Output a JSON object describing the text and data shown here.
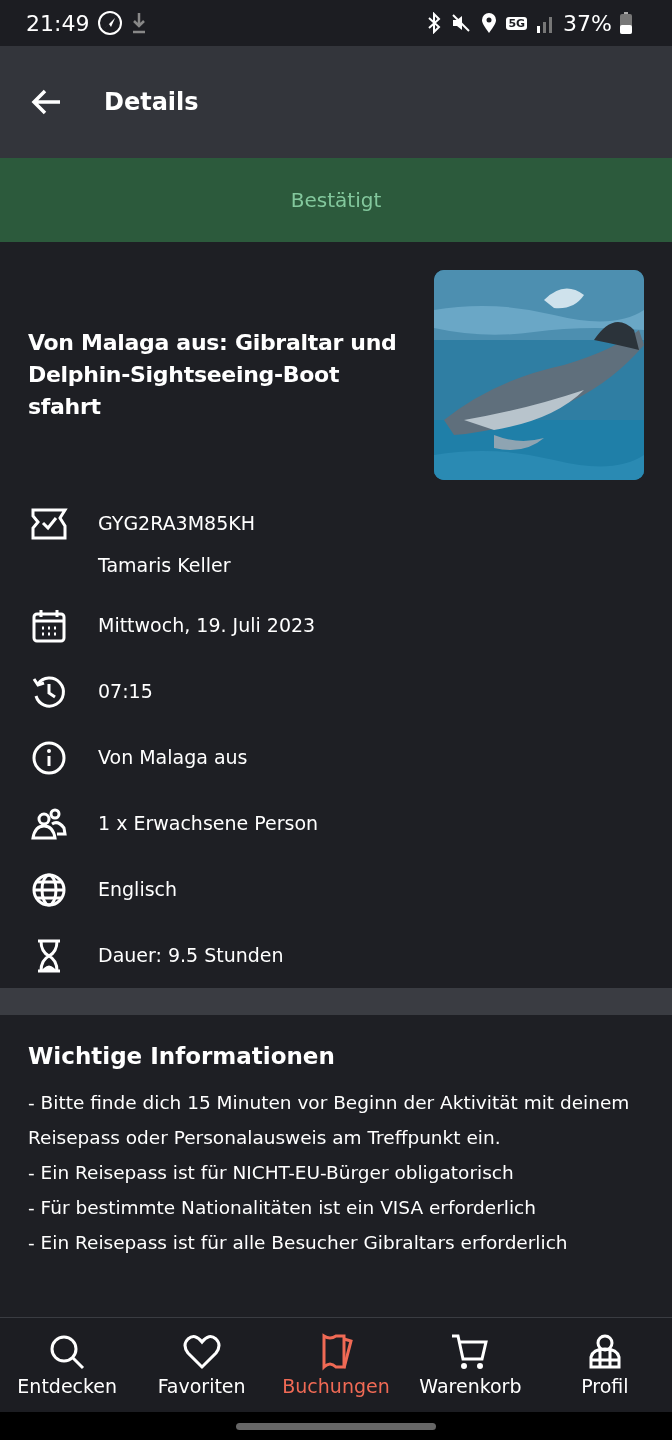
{
  "status_bar": {
    "time": "21:49",
    "battery": "37%",
    "network": "5G"
  },
  "app_bar": {
    "title": "Details"
  },
  "status_banner": {
    "label": "Bestätigt"
  },
  "activity": {
    "title": "Von Malaga aus: Gibraltar und Delphin-Sightseeing-Boot sfahrt"
  },
  "details": [
    {
      "kind": "ticket",
      "lines": [
        "GYG2RA3M85KH",
        "Tamaris Keller"
      ]
    },
    {
      "kind": "calendar",
      "lines": [
        "Mittwoch, 19. Juli 2023"
      ]
    },
    {
      "kind": "time",
      "lines": [
        "07:15"
      ]
    },
    {
      "kind": "info",
      "lines": [
        "Von Malaga aus"
      ]
    },
    {
      "kind": "people",
      "lines": [
        "1 x Erwachsene Person"
      ]
    },
    {
      "kind": "language",
      "lines": [
        "Englisch"
      ]
    },
    {
      "kind": "duration",
      "lines": [
        "Dauer: 9.5 Stunden"
      ]
    }
  ],
  "important_info": {
    "title": "Wichtige Informationen",
    "lines": [
      "- Bitte finde dich 15 Minuten vor Beginn der Aktivität mit deinem Reisepass oder Personalausweis am Treffpunkt ein.",
      "- Ein Reisepass ist für NICHT-EU-Bürger obligatorisch",
      "- Für bestimmte Nationalitäten ist ein VISA erforderlich",
      "- Ein Reisepass ist für alle Besucher Gibraltars erforderlich"
    ]
  },
  "bottom_nav": [
    {
      "kind": "search",
      "label": "Entdecken",
      "selected": false
    },
    {
      "kind": "heart",
      "label": "Favoriten",
      "selected": false
    },
    {
      "kind": "tickets",
      "label": "Buchungen",
      "selected": true
    },
    {
      "kind": "cart",
      "label": "Warenkorb",
      "selected": false
    },
    {
      "kind": "profile",
      "label": "Profil",
      "selected": false
    }
  ]
}
